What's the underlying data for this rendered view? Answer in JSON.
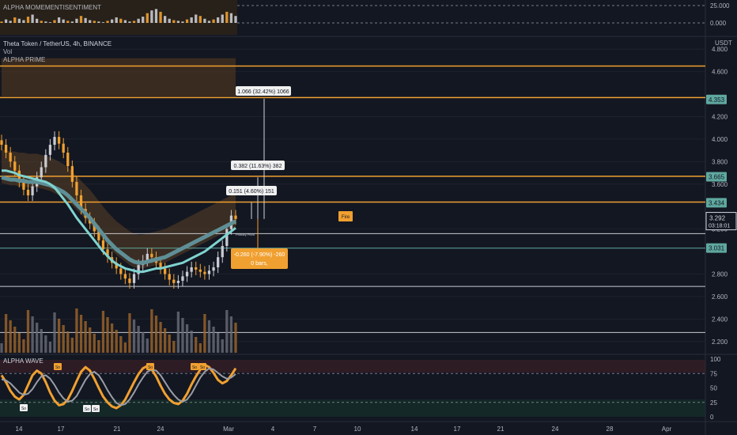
{
  "top_panel": {
    "title": "ALPHA MOMEMENTISENTIMENT",
    "ticks": [
      "25.000",
      "0.000"
    ]
  },
  "main_panel": {
    "symbol_line": "Theta Token / TetherUS, 4h, BINANCE",
    "indicator_1": "Vol",
    "indicator_2": "ALPHA PRIME",
    "currency": "USDT",
    "ticks": [
      {
        "v": 4.8,
        "label": "4.800"
      },
      {
        "v": 4.6,
        "label": "4.600"
      },
      {
        "v": 4.2,
        "label": "4.200"
      },
      {
        "v": 4.0,
        "label": "4.000"
      },
      {
        "v": 3.8,
        "label": "3.800"
      },
      {
        "v": 3.6,
        "label": "3.600"
      },
      {
        "v": 3.2,
        "label": "3.200"
      },
      {
        "v": 2.8,
        "label": "2.800"
      },
      {
        "v": 2.6,
        "label": "2.600"
      },
      {
        "v": 2.4,
        "label": "2.400"
      },
      {
        "v": 2.2,
        "label": "2.200"
      }
    ],
    "price_badges": [
      {
        "v": 4.353,
        "label": "4.353",
        "color": "#5fa8a0"
      },
      {
        "v": 3.665,
        "label": "3.665",
        "color": "#5fa8a0"
      },
      {
        "v": 3.434,
        "label": "3.434",
        "color": "#5fa8a0"
      },
      {
        "v": 3.031,
        "label": "3.031",
        "color": "#5fa8a0"
      }
    ],
    "current_price": {
      "v": 3.292,
      "label": "3.292",
      "countdown": "03:18:01"
    },
    "orange_levels": [
      4.65,
      4.37,
      3.67,
      3.44
    ],
    "white_levels": [
      3.16,
      2.69,
      2.28
    ],
    "teal_levels": [
      3.03
    ],
    "measurements": [
      {
        "label": "1.066 (32.42%) 1066",
        "style": "white"
      },
      {
        "label": "0.382 (11.63%) 382",
        "style": "white"
      },
      {
        "label": "0.151 (4.60%) 151",
        "style": "white"
      },
      {
        "label": "-0.260 (-7.90%) -260",
        "sub": "0 bars,",
        "style": "orange"
      }
    ],
    "markers": {
      "fire": "Fire",
      "pivot": "Primary Pivot"
    }
  },
  "bottom_panel": {
    "title": "ALPHA WAVE",
    "ticks": [
      "100",
      "75",
      "50",
      "25",
      "0"
    ],
    "signal_labels": [
      "So",
      "So",
      "So",
      "So",
      "So",
      "So",
      "So",
      "So",
      "So"
    ]
  },
  "time_axis": {
    "labels": [
      "14",
      "17",
      "21",
      "24",
      "Mar",
      "4",
      "7",
      "10",
      "14",
      "17",
      "21",
      "24",
      "28",
      "Apr"
    ]
  },
  "chart_data": {
    "type": "candlestick",
    "symbol": "Theta Token / TetherUS",
    "interval": "4h",
    "exchange": "BINANCE",
    "ylabel": "USDT",
    "ylim": [
      2.1,
      4.9
    ],
    "close_series": [
      3.95,
      3.88,
      3.8,
      3.72,
      3.62,
      3.55,
      3.5,
      3.58,
      3.66,
      3.75,
      3.86,
      3.95,
      4.02,
      3.96,
      3.88,
      3.76,
      3.62,
      3.5,
      3.38,
      3.3,
      3.25,
      3.18,
      3.1,
      3.02,
      2.95,
      2.9,
      2.85,
      2.8,
      2.76,
      2.72,
      2.8,
      2.88,
      2.92,
      2.98,
      2.95,
      2.9,
      2.85,
      2.8,
      2.75,
      2.72,
      2.74,
      2.78,
      2.82,
      2.86,
      2.84,
      2.82,
      2.8,
      2.83,
      2.86,
      2.95,
      3.05,
      3.2,
      3.32,
      3.29
    ],
    "ma_fast": [
      3.72,
      3.72,
      3.71,
      3.7,
      3.68,
      3.67,
      3.66,
      3.65,
      3.64,
      3.63,
      3.62,
      3.6,
      3.57,
      3.52,
      3.47,
      3.42,
      3.36,
      3.3,
      3.25,
      3.2,
      3.15,
      3.1,
      3.05,
      3.0,
      2.96,
      2.92,
      2.89,
      2.87,
      2.85,
      2.84,
      2.83,
      2.82,
      2.82,
      2.83,
      2.84,
      2.85,
      2.85,
      2.86,
      2.87,
      2.88,
      2.89,
      2.9,
      2.92,
      2.94,
      2.96,
      2.98,
      3.0,
      3.03,
      3.06,
      3.09,
      3.12,
      3.15,
      3.18,
      3.21
    ],
    "ma_slow": [
      3.66,
      3.65,
      3.64,
      3.64,
      3.63,
      3.63,
      3.62,
      3.62,
      3.62,
      3.61,
      3.6,
      3.59,
      3.57,
      3.55,
      3.53,
      3.5,
      3.46,
      3.42,
      3.38,
      3.34,
      3.3,
      3.25,
      3.2,
      3.15,
      3.1,
      3.06,
      3.02,
      2.99,
      2.96,
      2.93,
      2.91,
      2.9,
      2.9,
      2.91,
      2.92,
      2.93,
      2.94,
      2.95,
      2.97,
      2.99,
      3.01,
      3.03,
      3.05,
      3.07,
      3.09,
      3.11,
      3.13,
      3.15,
      3.17,
      3.19,
      3.21,
      3.23,
      3.25,
      3.27
    ],
    "current_price": 3.292,
    "momentum_sentiment": [
      2,
      5,
      3,
      8,
      6,
      4,
      9,
      12,
      6,
      3,
      2,
      1,
      4,
      8,
      5,
      3,
      2,
      6,
      10,
      7,
      4,
      3,
      2,
      1,
      3,
      5,
      8,
      6,
      4,
      2,
      3,
      6,
      9,
      14,
      18,
      20,
      16,
      10,
      6,
      4,
      3,
      2,
      5,
      8,
      12,
      10,
      6,
      3,
      5,
      8,
      12,
      16,
      14,
      10
    ],
    "alpha_wave": [
      72,
      60,
      45,
      35,
      30,
      38,
      55,
      72,
      80,
      75,
      60,
      42,
      28,
      20,
      22,
      30,
      45,
      62,
      78,
      86,
      80,
      66,
      50,
      35,
      25,
      18,
      15,
      20,
      30,
      45,
      60,
      74,
      84,
      88,
      82,
      70,
      54,
      40,
      30,
      24,
      22,
      28,
      40,
      56,
      70,
      82,
      90,
      86,
      76,
      64,
      58,
      62,
      72,
      84
    ],
    "alpha_wave_signal": [
      65,
      63,
      58,
      50,
      42,
      38,
      40,
      48,
      60,
      70,
      72,
      66,
      55,
      42,
      32,
      26,
      28,
      36,
      50,
      64,
      74,
      78,
      72,
      60,
      46,
      34,
      24,
      20,
      22,
      30,
      42,
      56,
      68,
      78,
      82,
      80,
      72,
      60,
      48,
      38,
      30,
      26,
      30,
      40,
      54,
      68,
      78,
      84,
      82,
      76,
      70,
      66,
      68,
      74
    ]
  }
}
